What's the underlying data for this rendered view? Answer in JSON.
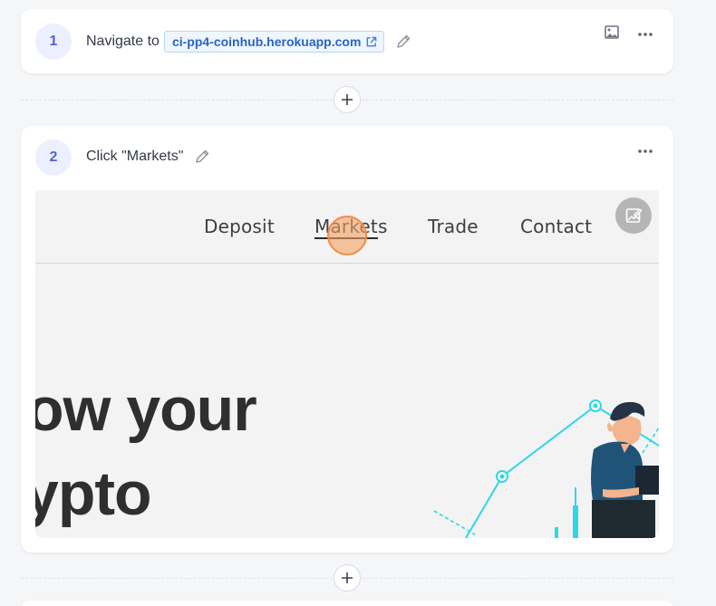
{
  "steps": [
    {
      "number": "1",
      "text": "Navigate to",
      "url_label": "ci-pp4-coinhub.herokuapp.com",
      "icons": [
        "external-link-icon",
        "pencil-icon",
        "image-icon",
        "more-icon"
      ]
    },
    {
      "number": "2",
      "text": "Click \"Markets\"",
      "icons": [
        "pencil-icon",
        "more-icon"
      ],
      "screenshot": {
        "nav": [
          "Deposit",
          "Markets",
          "Trade",
          "Contact"
        ],
        "hero_line_1": "ow your",
        "hero_line_2": "ypto",
        "click_target": "Markets",
        "edit_icon": "edit-image-icon"
      }
    }
  ],
  "add_step_icon": "plus-icon",
  "colors": {
    "background": "#f5f6f8",
    "card": "#ffffff",
    "accent": "#4f62d9",
    "step_badge_bg": "#eceffd",
    "url_chip_bg": "#eef6ff",
    "url_chip_border": "#b9d6f5",
    "url_text": "#2b63c4",
    "click_highlight": "#ef8d45",
    "chart_cyan": "#2ed8e8"
  }
}
